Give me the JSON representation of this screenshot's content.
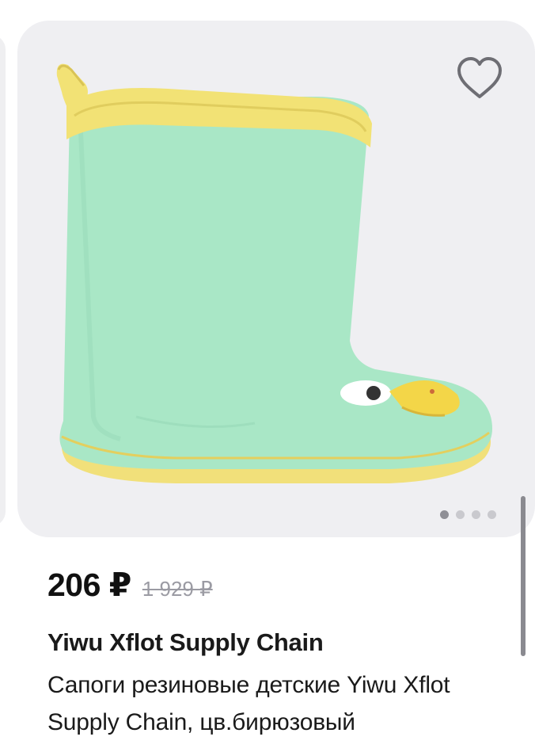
{
  "product": {
    "price": "206 ₽",
    "old_price": "1 929 ₽",
    "brand": "Yiwu Xflot Supply Chain",
    "title": "Сапоги резиновые детские Yiwu Xflot Supply Chain, цв.бирюзовый",
    "image_icon": "rubber-boot-image"
  },
  "gallery": {
    "total_images": 4,
    "active_index": 0
  },
  "icons": {
    "favorite": "heart-outline-icon"
  },
  "colors": {
    "card_background": "#efeff2",
    "boot_body": "#a8e8c6",
    "boot_trim": "#f3e27a",
    "price_text": "#111111",
    "old_price_text": "#9b9ba3"
  }
}
